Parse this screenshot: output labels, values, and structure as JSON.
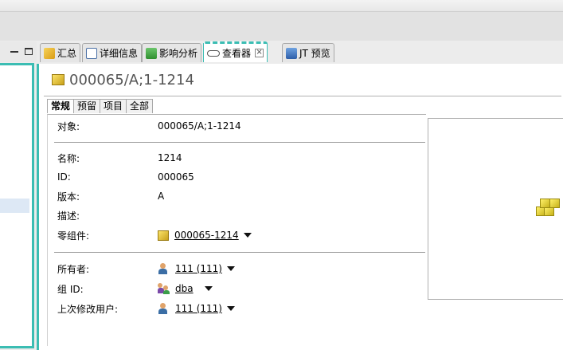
{
  "tabs": [
    {
      "label": "汇总",
      "icon": "summary-icon"
    },
    {
      "label": "详细信息",
      "icon": "details-icon"
    },
    {
      "label": "影响分析",
      "icon": "impact-analysis-icon"
    },
    {
      "label": "查看器",
      "icon": "viewer-icon",
      "active": true
    },
    {
      "label": "JT 预览",
      "icon": "jt-preview-icon"
    }
  ],
  "object": {
    "title": "000065/A;1-1214",
    "icon": "item-revision-icon"
  },
  "subtabs": [
    {
      "label": "常规",
      "active": true
    },
    {
      "label": "预留"
    },
    {
      "label": "项目"
    },
    {
      "label": "全部"
    }
  ],
  "fields": {
    "object": {
      "label": "对象:",
      "value": "000065/A;1-1214"
    },
    "name": {
      "label": "名称:",
      "value": "1214"
    },
    "id": {
      "label": "ID:",
      "value": "000065"
    },
    "revision": {
      "label": "版本:",
      "value": "A"
    },
    "description": {
      "label": "描述:",
      "value": ""
    },
    "part": {
      "label": "零组件:",
      "value": "000065-1214",
      "icon": "item-icon"
    },
    "owner": {
      "label": "所有者:",
      "value": "111 (111)",
      "icon": "user-icon"
    },
    "group": {
      "label": "组 ID:",
      "value": "dba",
      "icon": "group-icon"
    },
    "last_modified_user": {
      "label": "上次修改用户:",
      "value": "111 (111)",
      "icon": "user-icon"
    }
  },
  "colors": {
    "accent": "#3bbdb3",
    "selection": "#dde8f5"
  }
}
